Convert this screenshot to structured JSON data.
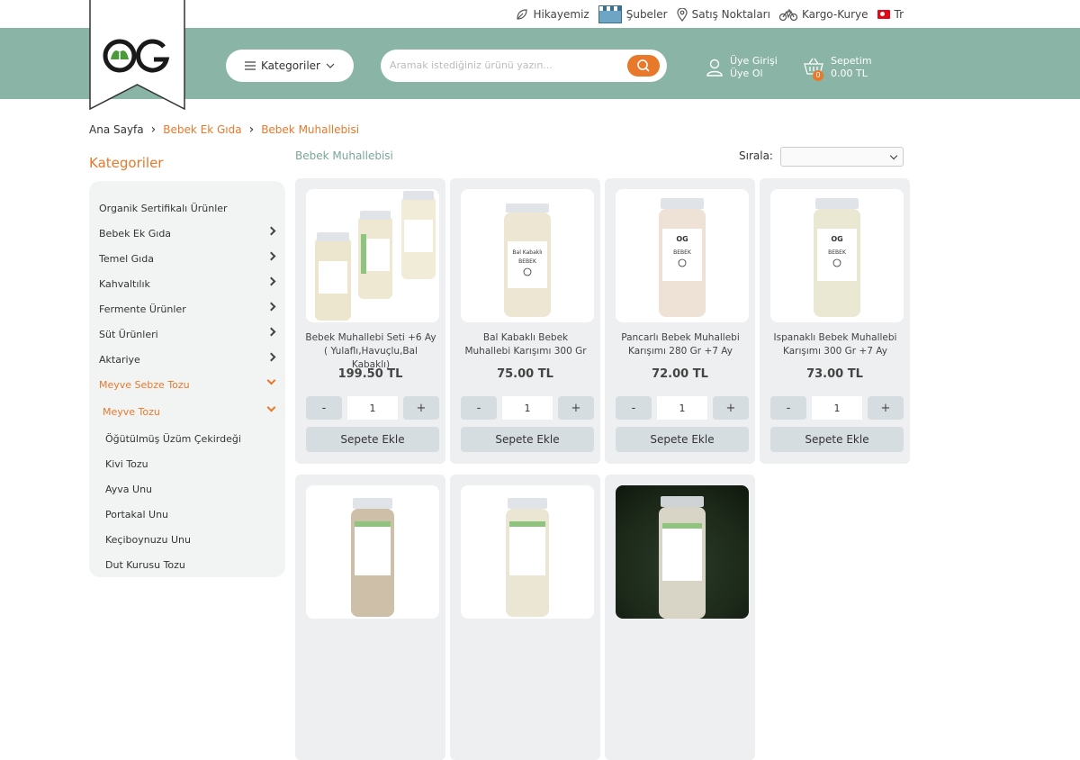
{
  "top_links": [
    {
      "label": "Hikayemiz",
      "icon": "leaf-icon"
    },
    {
      "label": "Şubeler",
      "icon": "store-icon"
    },
    {
      "label": "Satış Noktaları",
      "icon": "location-pin-icon"
    },
    {
      "label": "Kargo-Kurye",
      "icon": "bicycle-icon"
    },
    {
      "label": "Tr",
      "icon": "turkey-flag-icon"
    }
  ],
  "brand": {
    "logo_text": "OG",
    "accent": "#e8782a",
    "header_bg": "#8ab5a6",
    "logo_green": "#3f8f3a"
  },
  "header": {
    "categories_label": "Kategoriler",
    "search_placeholder": "Aramak istediğiniz ürünü yazın...",
    "user_login": "Üye Girişi",
    "user_register": "Üye Ol",
    "cart_label": "Sepetim",
    "cart_total": "0.00 TL",
    "cart_count": "0"
  },
  "breadcrumb": {
    "home": "Ana Sayfa",
    "level1": "Bebek Ek Gıda",
    "level2": "Bebek Muhallebisi"
  },
  "sidebar": {
    "title": "Kategoriler",
    "items": [
      {
        "label": "Organik Sertifikalı Ürünler"
      },
      {
        "label": "Bebek Ek Gıda"
      },
      {
        "label": "Temel Gıda"
      },
      {
        "label": "Kahvaltılık"
      },
      {
        "label": "Fermente Ürünler"
      },
      {
        "label": "Süt Ürünleri"
      },
      {
        "label": "Aktariye"
      },
      {
        "label": "Meyve Sebze Tozu"
      },
      {
        "label": "Meyve Tozu"
      },
      {
        "label": "Öğütülmüş Üzüm Çekirdeği"
      },
      {
        "label": "Kivi Tozu"
      },
      {
        "label": "Ayva Unu"
      },
      {
        "label": "Portakal Unu"
      },
      {
        "label": "Keçiboynuzu Unu"
      },
      {
        "label": "Dut Kurusu Tozu"
      }
    ]
  },
  "listing": {
    "title": "Bebek Muhallebisi",
    "sort_label": "Sırala:"
  },
  "products": [
    {
      "name": "Bebek Muhallebi Seti +6 Ay ( Yulaflı,Havuçlu,Bal Kabaklı)",
      "price": "199.50 TL",
      "qty": "1",
      "add_label": "Sepete Ekle",
      "minus": "-",
      "plus": "+"
    },
    {
      "name": "Bal Kabaklı Bebek Muhallebi Karışımı 300 Gr",
      "price": "75.00 TL",
      "qty": "1",
      "add_label": "Sepete Ekle",
      "minus": "-",
      "plus": "+"
    },
    {
      "name": "Pancarlı Bebek Muhallebi Karışımı 280 Gr +7 Ay",
      "price": "72.00 TL",
      "qty": "1",
      "add_label": "Sepete Ekle",
      "minus": "-",
      "plus": "+"
    },
    {
      "name": "Ispanaklı Bebek Muhallebi Karışımı 300 Gr +7 Ay",
      "price": "73.00 TL",
      "qty": "1",
      "add_label": "Sepete Ekle",
      "minus": "-",
      "plus": "+"
    }
  ]
}
